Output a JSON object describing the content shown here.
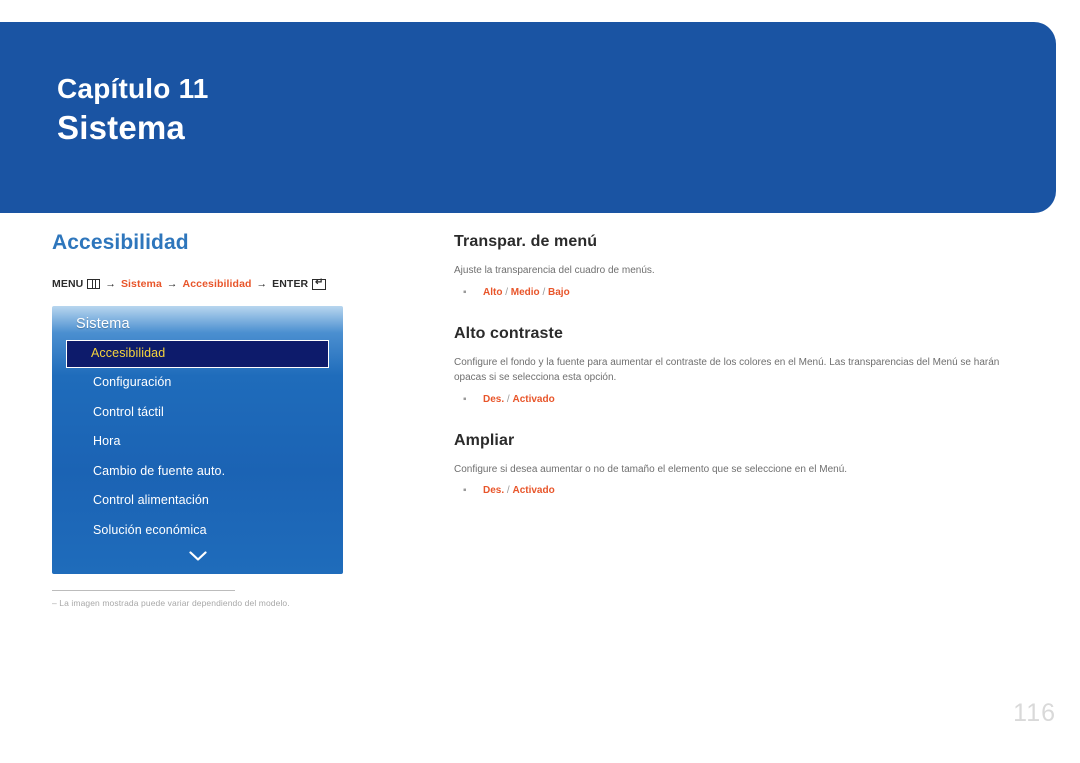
{
  "banner": {
    "chapter_label": "Capítulo 11",
    "chapter_title": "Sistema",
    "color": "#1a54a3"
  },
  "left": {
    "section_title": "Accesibilidad",
    "menu_path": {
      "menu_label": "MENU",
      "menu_icon": "menu-icon",
      "arrow": "→",
      "step1": "Sistema",
      "step2": "Accesibilidad",
      "enter_label": "ENTER",
      "enter_icon": "enter-key-icon"
    },
    "osd": {
      "header": "Sistema",
      "items": [
        {
          "label": "Accesibilidad",
          "selected": true
        },
        {
          "label": "Configuración",
          "selected": false
        },
        {
          "label": "Control táctil",
          "selected": false
        },
        {
          "label": "Hora",
          "selected": false
        },
        {
          "label": "Cambio de fuente auto.",
          "selected": false
        },
        {
          "label": "Control alimentación",
          "selected": false
        },
        {
          "label": "Solución económica",
          "selected": false
        }
      ],
      "scroll_icon": "chevron-down-icon",
      "selected_text_color": "#f4d33e",
      "selected_bg_color": "#0d1b6b"
    },
    "footnote": "‒ La imagen mostrada puede variar dependiendo del modelo."
  },
  "right": {
    "topics": [
      {
        "title": "Transpar. de menú",
        "description": "Ajuste la transparencia del cuadro de menús.",
        "values": [
          "Alto",
          "Medio",
          "Bajo"
        ],
        "values_text": "Alto / Medio / Bajo"
      },
      {
        "title": "Alto contraste",
        "description": "Configure el fondo y la fuente para aumentar el contraste de los colores en el Menú. Las transparencias del Menú se harán opacas si se selecciona esta opción.",
        "values": [
          "Des.",
          "Activado"
        ],
        "values_text": "Des. / Activado"
      },
      {
        "title": "Ampliar",
        "description": "Configure si desea aumentar o no de tamaño el elemento que se seleccione en el Menú.",
        "values": [
          "Des.",
          "Activado"
        ],
        "values_text": "Des. / Activado"
      }
    ],
    "accent_color": "#e8552a"
  },
  "page_number": "116"
}
